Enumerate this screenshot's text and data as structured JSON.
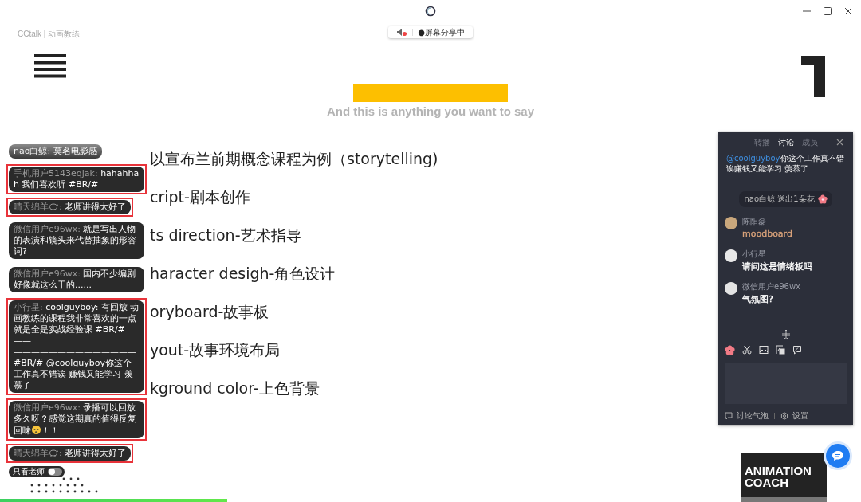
{
  "app": {
    "title": "CCtalk | 动画教练",
    "share_status": "●屏幕分享中",
    "mic_muted": true
  },
  "slide": {
    "subtitle": "And this is anything you want to say",
    "items": [
      "以宣布兰前期概念课程为例（storytelling)",
      "cript-剧本创作",
      "ts direction-艺术指导",
      "haracter desigh-角色设计",
      "oryboard-故事板",
      "yout-故事环境布局",
      "kground color-上色背景"
    ]
  },
  "danmaku": [
    {
      "name": "nao白鲸",
      "separator": ":",
      "badge": false,
      "message": "莫名电影感",
      "faded": true,
      "highlighted": false
    },
    {
      "name": "手机用户5143eqjak",
      "separator": ":",
      "badge": false,
      "message": "hahahhah 我们喜欢听 #BR/#",
      "faded": false,
      "highlighted": true
    },
    {
      "name": "晴天绵羊",
      "separator": ":",
      "badge": true,
      "message": "老师讲得太好了",
      "faded": false,
      "highlighted": true
    },
    {
      "name": "微信用户e96wx",
      "separator": ":",
      "badge": false,
      "message": "就是写出人物的表演和镜头来代替抽象的形容词?",
      "faded": false,
      "highlighted": false
    },
    {
      "name": "微信用户e96wx",
      "separator": ":",
      "badge": false,
      "message": "国内不少编剧好像就这么干的......",
      "faded": false,
      "highlighted": false
    },
    {
      "name": "小行星",
      "separator": ":",
      "badge": false,
      "message": "coolguyboy: 有回放 动画教练的课程我非常喜欢的一点就是全是实战经验课 #BR/#—— —————————————— #BR/# @coolguyboy你这个工作真不错诶 赚钱又能学习 羡慕了",
      "faded": false,
      "highlighted": true
    },
    {
      "name": "微信用户e96wx",
      "separator": ":",
      "badge": false,
      "message": "录播可以回放多久呀？感觉这期真的值得反复回味",
      "emoji": true,
      "tail": "！！",
      "faded": false,
      "highlighted": true
    },
    {
      "name": "晴天绵羊",
      "separator": ":",
      "badge": true,
      "message": "老师讲得太好了",
      "faded": false,
      "highlighted": true
    }
  ],
  "teacher_only": {
    "label": "只看老师",
    "on": false
  },
  "chat_panel": {
    "tabs": [
      {
        "label": "转播",
        "selected": false
      },
      {
        "label": "讨论",
        "selected": true
      },
      {
        "label": "成员",
        "selected": false
      }
    ],
    "messages": [
      {
        "kind": "mention",
        "mention": "@coolguyboy",
        "text": "你这个工作真不错诶赚钱又能学习 羡慕了"
      },
      {
        "kind": "gift",
        "text": "nao白鲸 送出1朵花"
      },
      {
        "kind": "user",
        "name": "陈阳磊",
        "text": "moodboard",
        "color": "#d9a27a"
      },
      {
        "kind": "user",
        "name": "小行星",
        "text": "请问这是情绪板吗",
        "color": "#ffffff"
      },
      {
        "kind": "user",
        "name": "微信用户e96wx",
        "text": "气氛图?",
        "color": "#ffffff"
      }
    ],
    "footer": [
      {
        "kind": "bubble",
        "label": "讨论气泡"
      },
      {
        "kind": "settings",
        "label": "设置"
      }
    ]
  },
  "logo_badge": {
    "lines": [
      "ANIMATION",
      "COACH"
    ]
  },
  "playback": {
    "level": 0.264
  }
}
